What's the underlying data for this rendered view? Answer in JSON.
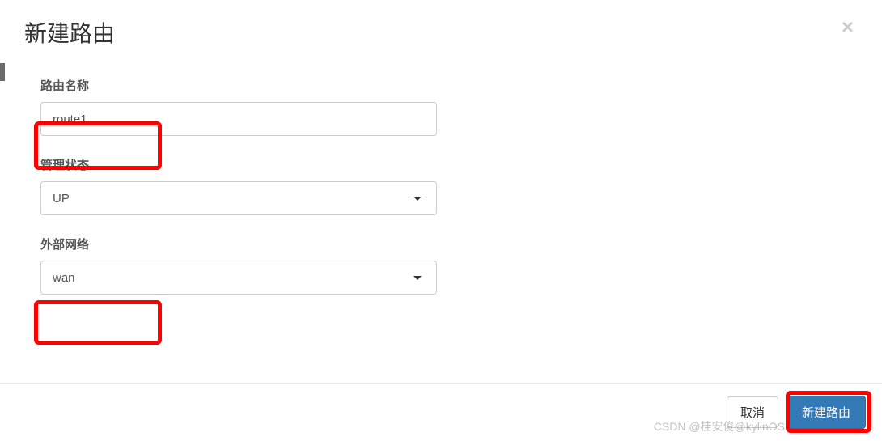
{
  "modal": {
    "title": "新建路由"
  },
  "form": {
    "route_name_label": "路由名称",
    "route_name_value": "route1",
    "admin_state_label": "管理状态",
    "admin_state_value": "UP",
    "external_net_label": "外部网络",
    "external_net_value": "wan"
  },
  "footer": {
    "cancel_label": "取消",
    "submit_label": "新建路由"
  },
  "watermark": "CSDN @桂安俊@kylinOS"
}
